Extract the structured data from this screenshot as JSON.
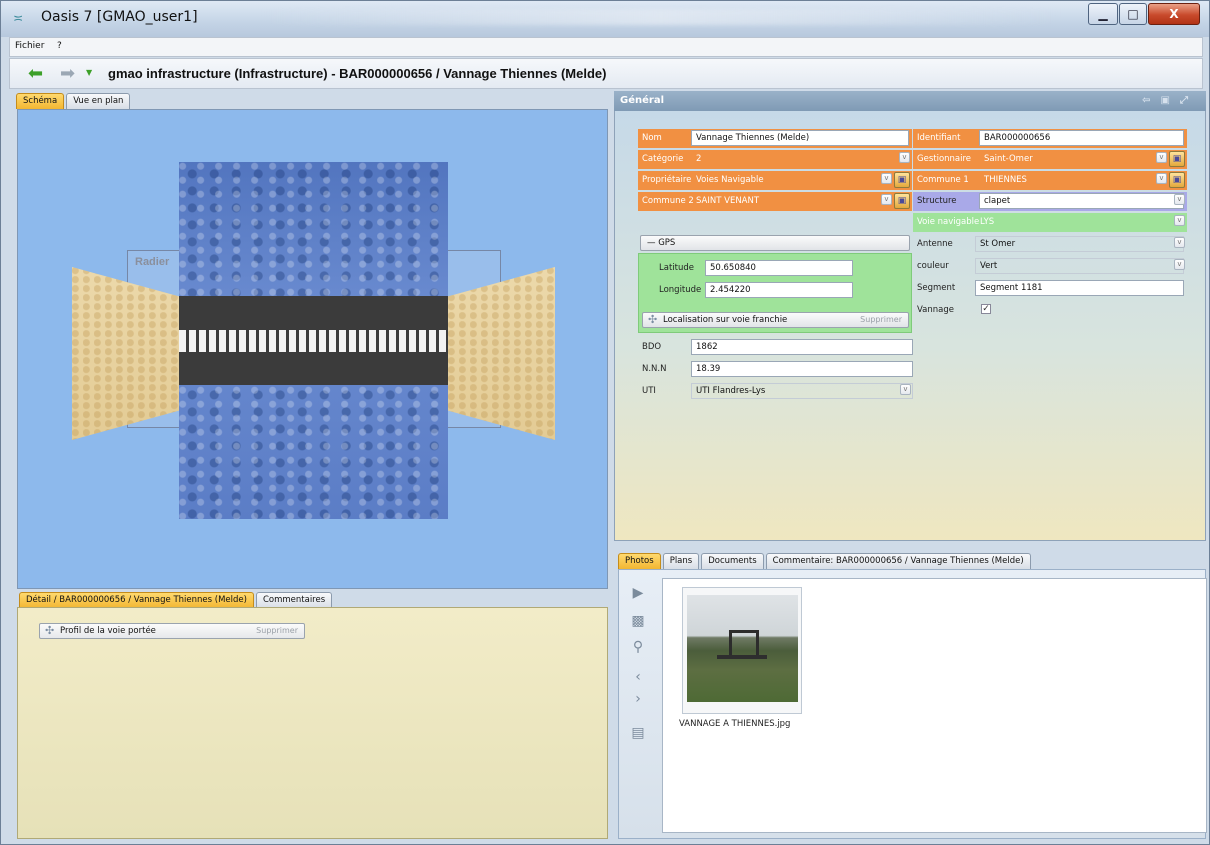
{
  "window": {
    "title": "Oasis 7 [GMAO_user1]",
    "minimize": "▁",
    "maximize": "□",
    "close": "X"
  },
  "menu": {
    "items": [
      "Fichier",
      "?"
    ]
  },
  "nav": {
    "title": "gmao infrastructure (Infrastructure) - BAR000000656 / Vannage Thiennes (Melde)"
  },
  "left": {
    "tabs": [
      "Schéma",
      "Vue en plan"
    ],
    "schema": {
      "radier_label": "Radier"
    },
    "detail_tabs": [
      "Détail / BAR000000656 / Vannage Thiennes (Melde)",
      "Commentaires"
    ],
    "detail_button": {
      "label": "Profil de la voie portée",
      "supprimer": "Supprimer"
    }
  },
  "general": {
    "header": "Général",
    "nom": {
      "label": "Nom",
      "value": "Vannage Thiennes (Melde)"
    },
    "identifiant": {
      "label": "Identifiant",
      "value": "BAR000000656"
    },
    "categorie": {
      "label": "Catégorie",
      "value": "2"
    },
    "gestionnaire": {
      "label": "Gestionnaire",
      "value": "Saint-Omer"
    },
    "proprietaire": {
      "label": "Propriétaire",
      "value": "Voies Navigable"
    },
    "commune1": {
      "label": "Commune 1",
      "value": "THIENNES"
    },
    "commune2": {
      "label": "Commune 2",
      "value": "SAINT VENANT"
    },
    "structure": {
      "label": "Structure",
      "value": "clapet"
    },
    "gps": {
      "label": "GPS",
      "latitude_label": "Latitude",
      "latitude": "50.650840",
      "longitude_label": "Longitude",
      "longitude": "2.454220"
    },
    "voie_navigable": {
      "label": "Voie navigable",
      "value": "LYS"
    },
    "antenne": {
      "label": "Antenne",
      "value": "St Omer"
    },
    "couleur": {
      "label": "couleur",
      "value": "Vert"
    },
    "segment": {
      "label": "Segment",
      "value": "Segment 1181"
    },
    "vannage": {
      "label": "Vannage",
      "checked": true
    },
    "localisation": {
      "label": "Localisation sur voie franchie",
      "supprimer": "Supprimer"
    },
    "bdo": {
      "label": "BDO",
      "value": "1862"
    },
    "nnn": {
      "label": "N.N.N",
      "value": "18.39"
    },
    "uti": {
      "label": "UTI",
      "value": "UTI Flandres-Lys"
    }
  },
  "photos": {
    "tabs": [
      "Photos",
      "Plans",
      "Documents",
      "Commentaire: BAR000000656 / Vannage Thiennes (Melde)"
    ],
    "items": [
      {
        "caption": "VANNAGE A THIENNES.jpg"
      }
    ]
  },
  "colors": {
    "orange": "#f19042",
    "purple": "#a9a9e8",
    "green": "#9fe39a",
    "active_tab": "#f2b632"
  }
}
